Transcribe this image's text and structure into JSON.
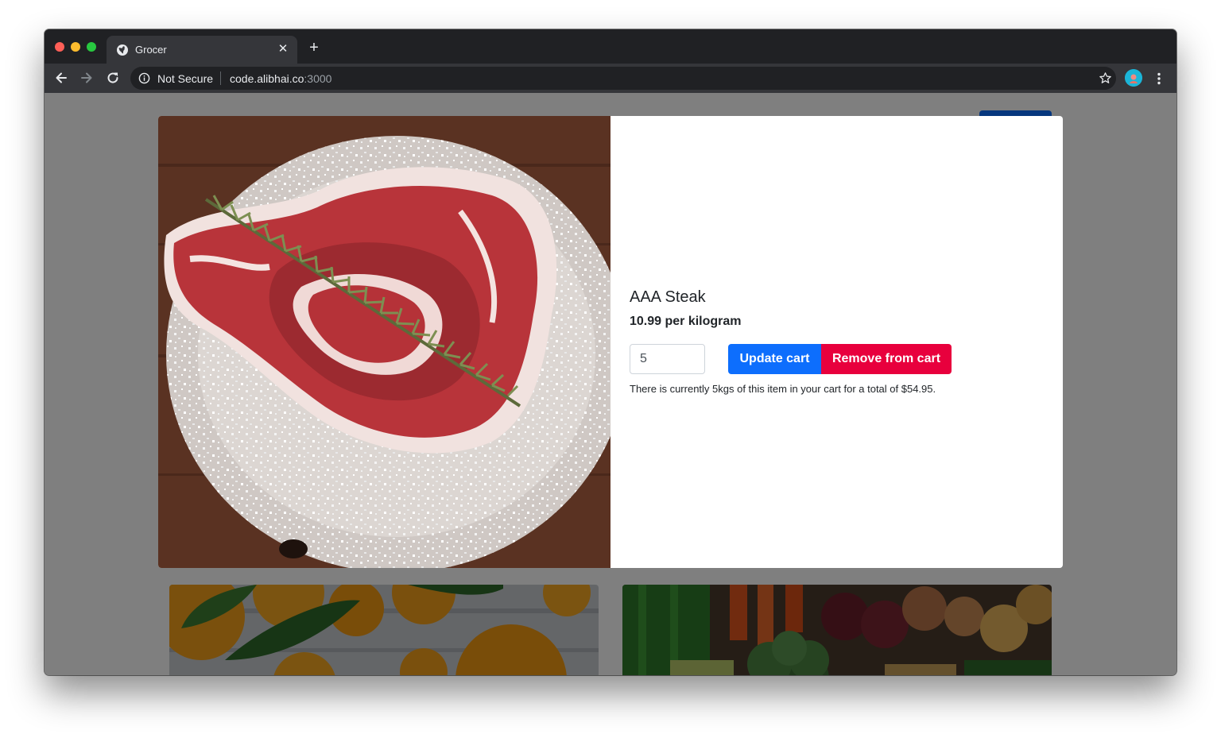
{
  "browser": {
    "tab_title": "Grocer",
    "tab_close_glyph": "✕",
    "new_tab_glyph": "+",
    "security_label": "Not Secure",
    "url_host": "code.alibhai.co",
    "url_port": ":3000"
  },
  "modal": {
    "product_name": "AAA Steak",
    "price_text": "10.99 per kilogram",
    "quantity_value": "5",
    "update_button_label": "Update cart",
    "remove_button_label": "Remove from cart",
    "cart_message": "There is currently 5kgs of this item in your cart for a total of $54.95."
  },
  "colors": {
    "primary_button": "#0d6efd",
    "danger_button": "#e8003d",
    "backdrop": "rgba(0,0,0,0.5)"
  },
  "icons": [
    "globe-icon",
    "close-icon",
    "plus-icon",
    "back-arrow-icon",
    "forward-arrow-icon",
    "reload-icon",
    "info-icon",
    "star-icon",
    "profile-avatar",
    "more-vert-icon"
  ]
}
